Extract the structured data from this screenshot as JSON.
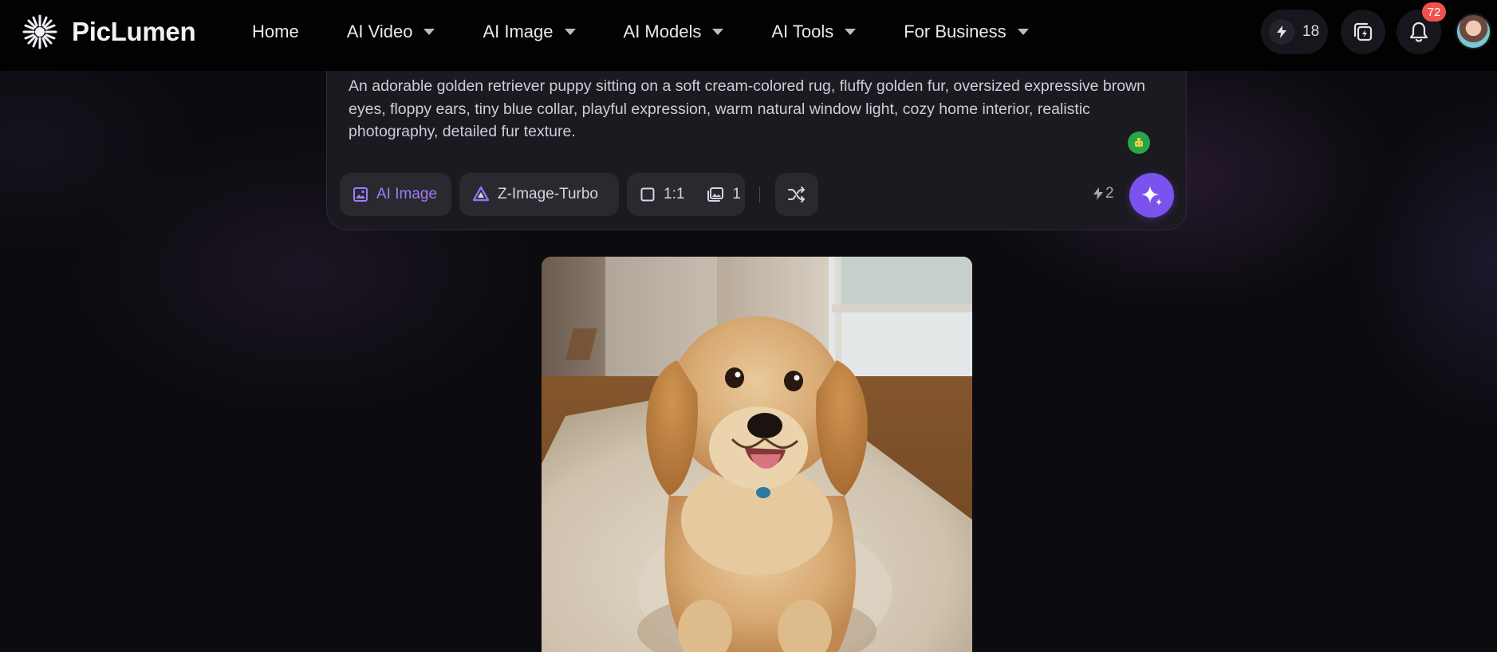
{
  "brand": {
    "name": "PicLumen"
  },
  "nav": {
    "items": [
      {
        "label": "Home",
        "has_menu": false
      },
      {
        "label": "AI Video",
        "has_menu": true
      },
      {
        "label": "AI Image",
        "has_menu": true
      },
      {
        "label": "AI Models",
        "has_menu": true
      },
      {
        "label": "AI Tools",
        "has_menu": true
      },
      {
        "label": "For Business",
        "has_menu": true
      }
    ]
  },
  "header": {
    "credits": "18",
    "notification_count": "72",
    "icons": [
      "bolt-icon",
      "tasks-icon",
      "bell-icon",
      "avatar"
    ]
  },
  "prompt": {
    "text": "An adorable golden retriever puppy sitting on a soft cream-colored rug, fluffy golden fur, oversized expressive brown eyes, floppy ears, tiny blue collar, playful expression, warm natural window light, cozy home interior, realistic photography, detailed fur texture."
  },
  "toolbar": {
    "mode_label": "AI Image",
    "model_label": "Z-Image-Turbo",
    "aspect_ratio": "1:1",
    "image_count": "1",
    "cost": "2"
  },
  "colors": {
    "accent": "#7b52ee",
    "accent_text": "#9f7cf6",
    "badge": "#f0524d",
    "background": "#0c0b0f",
    "header": "#020203"
  }
}
